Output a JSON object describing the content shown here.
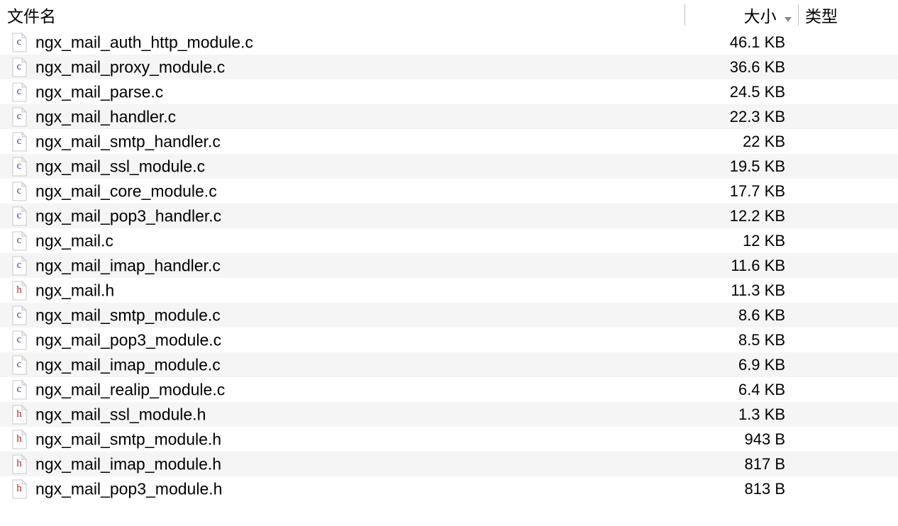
{
  "headers": {
    "name": "文件名",
    "size": "大小",
    "type": "类型"
  },
  "files": [
    {
      "name": "ngx_mail_auth_http_module.c",
      "size": "46.1 KB",
      "ext": "c"
    },
    {
      "name": "ngx_mail_proxy_module.c",
      "size": "36.6 KB",
      "ext": "c"
    },
    {
      "name": "ngx_mail_parse.c",
      "size": "24.5 KB",
      "ext": "c"
    },
    {
      "name": "ngx_mail_handler.c",
      "size": "22.3 KB",
      "ext": "c"
    },
    {
      "name": "ngx_mail_smtp_handler.c",
      "size": "22 KB",
      "ext": "c"
    },
    {
      "name": "ngx_mail_ssl_module.c",
      "size": "19.5 KB",
      "ext": "c"
    },
    {
      "name": "ngx_mail_core_module.c",
      "size": "17.7 KB",
      "ext": "c"
    },
    {
      "name": "ngx_mail_pop3_handler.c",
      "size": "12.2 KB",
      "ext": "c"
    },
    {
      "name": "ngx_mail.c",
      "size": "12 KB",
      "ext": "c"
    },
    {
      "name": "ngx_mail_imap_handler.c",
      "size": "11.6 KB",
      "ext": "c"
    },
    {
      "name": "ngx_mail.h",
      "size": "11.3 KB",
      "ext": "h"
    },
    {
      "name": "ngx_mail_smtp_module.c",
      "size": "8.6 KB",
      "ext": "c"
    },
    {
      "name": "ngx_mail_pop3_module.c",
      "size": "8.5 KB",
      "ext": "c"
    },
    {
      "name": "ngx_mail_imap_module.c",
      "size": "6.9 KB",
      "ext": "c"
    },
    {
      "name": "ngx_mail_realip_module.c",
      "size": "6.4 KB",
      "ext": "c"
    },
    {
      "name": "ngx_mail_ssl_module.h",
      "size": "1.3 KB",
      "ext": "h"
    },
    {
      "name": "ngx_mail_smtp_module.h",
      "size": "943 B",
      "ext": "h"
    },
    {
      "name": "ngx_mail_imap_module.h",
      "size": "817 B",
      "ext": "h"
    },
    {
      "name": "ngx_mail_pop3_module.h",
      "size": "813 B",
      "ext": "h"
    }
  ]
}
